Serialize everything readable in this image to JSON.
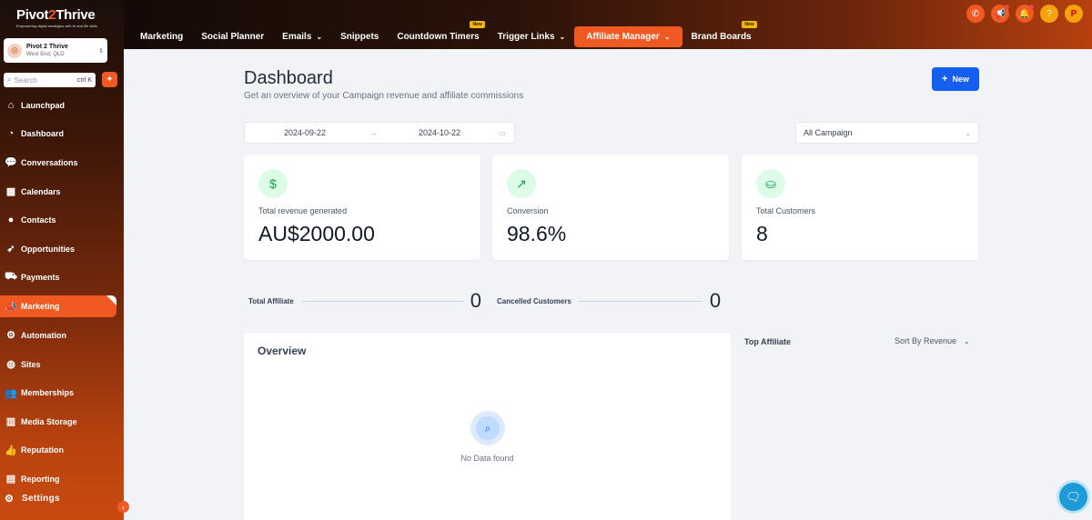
{
  "brand": {
    "name_a": "Pivot",
    "name_o": "2",
    "name_b": "Thrive",
    "tagline": "Empowering digital strategies with AI and life skills"
  },
  "location": {
    "name": "Pivot 2 Thrive",
    "sub": "West End, QLD"
  },
  "search": {
    "placeholder": "Search",
    "shortcut": "ctrl K"
  },
  "sidebar": {
    "items": [
      {
        "label": "Launchpad",
        "icon": "home-icon",
        "glyph": "⌂"
      },
      {
        "label": "Dashboard",
        "icon": "gauge-icon",
        "glyph": "◔"
      },
      {
        "label": "Conversations",
        "icon": "chat-icon",
        "glyph": "💬"
      },
      {
        "label": "Calendars",
        "icon": "calendar-icon",
        "glyph": "▦"
      },
      {
        "label": "Contacts",
        "icon": "user-icon",
        "glyph": "●"
      },
      {
        "label": "Opportunities",
        "icon": "rocket-icon",
        "glyph": "➶"
      },
      {
        "label": "Payments",
        "icon": "cart-icon",
        "glyph": "⛟"
      },
      {
        "label": "Marketing",
        "icon": "megaphone-icon",
        "glyph": "📣"
      },
      {
        "label": "Automation",
        "icon": "cog-icon",
        "glyph": "⚙"
      },
      {
        "label": "Sites",
        "icon": "globe-icon",
        "glyph": "◍"
      },
      {
        "label": "Memberships",
        "icon": "users-icon",
        "glyph": "👥"
      },
      {
        "label": "Media Storage",
        "icon": "chart-icon",
        "glyph": "▥"
      },
      {
        "label": "Reputation",
        "icon": "thumbs-up-icon",
        "glyph": "👍"
      },
      {
        "label": "Reporting",
        "icon": "report-icon",
        "glyph": "▤"
      }
    ],
    "active": "Marketing",
    "settings_label": "Settings"
  },
  "topnav": {
    "tabs": [
      {
        "label": "Marketing",
        "chevron": false,
        "new": false
      },
      {
        "label": "Social Planner",
        "chevron": false,
        "new": false
      },
      {
        "label": "Emails",
        "chevron": true,
        "new": false
      },
      {
        "label": "Snippets",
        "chevron": false,
        "new": false
      },
      {
        "label": "Countdown Timers",
        "chevron": false,
        "new": true
      },
      {
        "label": "Trigger Links",
        "chevron": true,
        "new": false
      },
      {
        "label": "Affiliate Manager",
        "chevron": true,
        "new": false,
        "active": true
      },
      {
        "label": "Brand Boards",
        "chevron": false,
        "new": true
      }
    ],
    "new_badge": "New"
  },
  "page": {
    "title": "Dashboard",
    "subtitle": "Get an overview of your Campaign revenue and affiliate commissions",
    "new_button": "New",
    "date_start": "2024-09-22",
    "date_end": "2024-10-22",
    "campaign_select": "All Campaign"
  },
  "cards": [
    {
      "label": "Total revenue generated",
      "value": "AU$2000.00",
      "icon": "dollar-icon"
    },
    {
      "label": "Conversion",
      "value": "98.6%",
      "icon": "trending-up-icon"
    },
    {
      "label": "Total Customers",
      "value": "8",
      "icon": "hand-coins-icon"
    }
  ],
  "stats": {
    "total_affiliate_label": "Total Affiliate",
    "total_affiliate_value": "0",
    "cancelled_label": "Cancelled Customers",
    "cancelled_value": "0"
  },
  "overview": {
    "title": "Overview",
    "empty": "No Data found"
  },
  "top_affiliate": {
    "title": "Top Affiliate",
    "sort": "Sort By Revenue"
  },
  "colors": {
    "accent": "#f05a22",
    "primary": "#155eef",
    "success": "#16a34a"
  }
}
